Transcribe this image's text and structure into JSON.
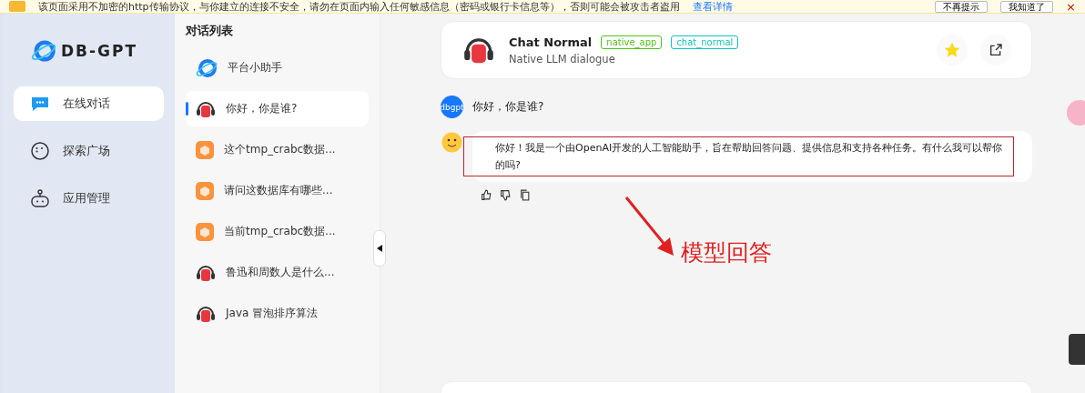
{
  "banner": {
    "message": "该页面采用不加密的http传输协议，与你建立的连接不安全，请勿在页面内输入任何敏感信息（密码或银行卡信息等），否则可能会被攻击者盗用",
    "link": "查看详情",
    "buttons": [
      "不再提示",
      "我知道了"
    ],
    "close": "×"
  },
  "sidebar": {
    "logo": "DB-GPT",
    "items": [
      {
        "label": "在线对话",
        "kind": "chat",
        "selected": true
      },
      {
        "label": "探索广场",
        "kind": "face",
        "selected": false
      },
      {
        "label": "应用管理",
        "kind": "robot",
        "selected": false
      }
    ]
  },
  "conversations": {
    "title": "对话列表",
    "items": [
      {
        "label": "平台小助手",
        "kind": "planet",
        "selected": false
      },
      {
        "label": "你好，你是谁?",
        "kind": "headset",
        "selected": true
      },
      {
        "label": "这个tmp_crabc数据...",
        "kind": "cube",
        "selected": false
      },
      {
        "label": "请问这数据库有哪些...",
        "kind": "cube",
        "selected": false
      },
      {
        "label": "当前tmp_crabc数据...",
        "kind": "cube",
        "selected": false
      },
      {
        "label": "鲁迅和周数人是什么...",
        "kind": "headset",
        "selected": false
      },
      {
        "label": "Java 冒泡排序算法",
        "kind": "headset",
        "selected": false
      }
    ]
  },
  "chat": {
    "app": {
      "name": "Chat Normal",
      "tags": [
        {
          "label": "native_app",
          "color": "#52c41a"
        },
        {
          "label": "chat_normal",
          "color": "#13c2c2"
        }
      ],
      "description": "Native LLM dialogue",
      "starred": true
    },
    "messages": [
      {
        "kind": "user",
        "avatar": "dbgpt",
        "text": "你好，你是谁?"
      },
      {
        "kind": "assistant",
        "text": "你好！我是一个由OpenAI开发的人工智能助手，旨在帮助回答问题、提供信息和支持各种任务。有什么我可以帮你的吗?"
      }
    ]
  },
  "annotation": {
    "label": "模型回答"
  }
}
